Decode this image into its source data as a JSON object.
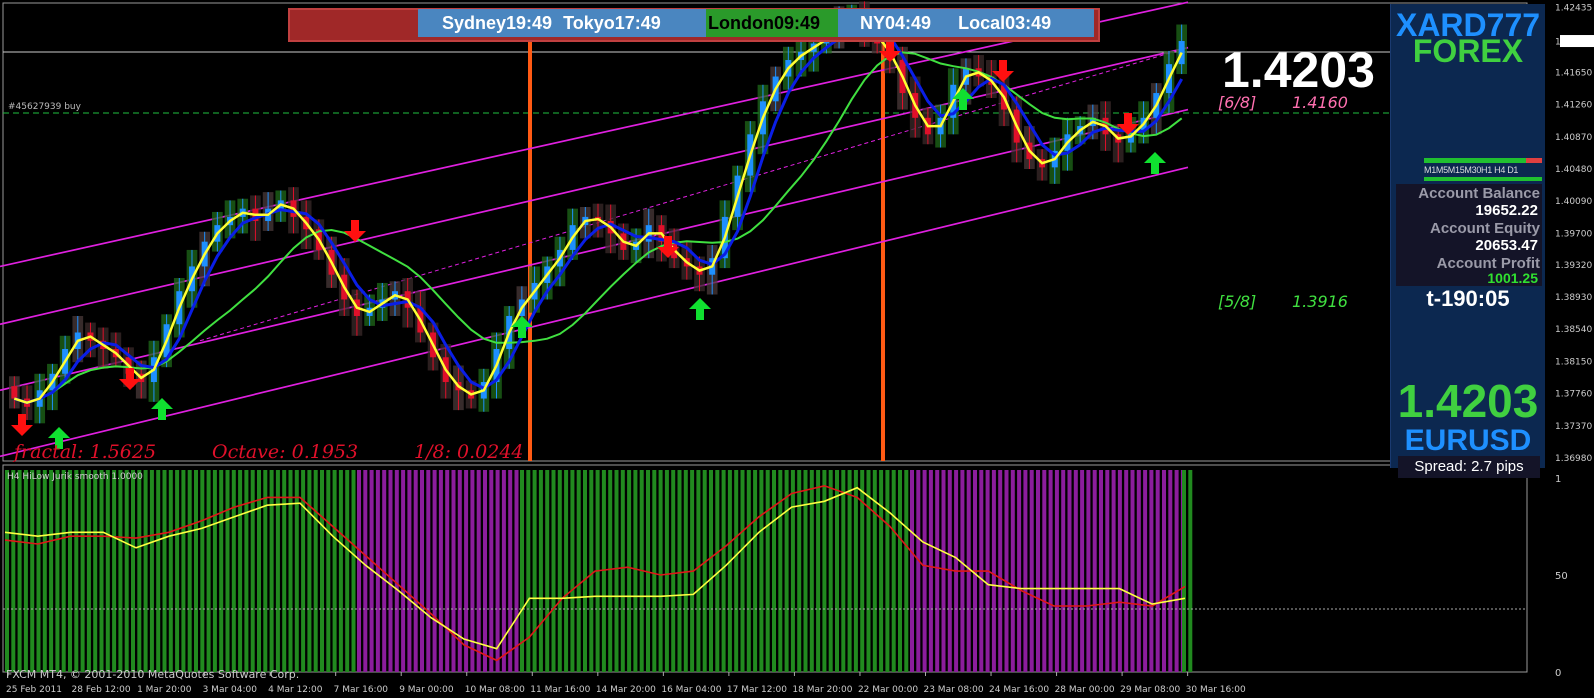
{
  "sessions": {
    "sydney_label": "Sydney",
    "sydney_time": "19:49",
    "tokyo_label": "Tokyo",
    "tokyo_time": "17:49",
    "london_label": "London",
    "london_time": "09:49",
    "ny_label": "NY",
    "ny_time": "04:49",
    "local_label": "Local",
    "local_time": "03:49"
  },
  "order_label": "#45627939 buy",
  "big_price": "1.4203",
  "levels": {
    "six_eighths": "[6/8]",
    "six_eighths_value": "1.4160",
    "five_eighths": "[5/8]",
    "five_eighths_value": "1.3916"
  },
  "fractal_info": {
    "fractal": "fractal: 1.5625",
    "octave": "Octave: 0.1953",
    "eighth": "1/8: 0.0244"
  },
  "indicator_label": "H4 HiLow Jurik smooth 1.0000",
  "copyright": "FXCM MT4, © 2001-2010 MetaQuotes Software Corp.",
  "panel": {
    "brand_top": "XARD777",
    "brand_bottom": "FOREX",
    "timeframes": "M1M5M15M30H1 H4 D1",
    "account_balance_label": "Account Balance",
    "account_balance": "19652.22",
    "account_equity_label": "Account Equity",
    "account_equity": "20653.47",
    "account_profit_label": "Account Profit",
    "account_profit": "1001.25",
    "countdown": "t-190:05",
    "price": "1.4203",
    "symbol": "EURUSD",
    "spread": "Spread: 2.7 pips"
  },
  "colors": {
    "background": "#000000",
    "bull_candle": "#1e90ff",
    "bear_candle": "#e0102a",
    "channel": "#e020e0",
    "ma_blue": "#0a1ee6",
    "ma_green": "#40e040",
    "ma_yellow": "#ffff33",
    "session_line": "#ff5a14",
    "panel_bg": "#0c2850",
    "bar_green": "#218a1f",
    "bar_purple": "#8b1d9c"
  },
  "chart_data": [
    {
      "type": "candlestick",
      "symbol": "EURUSD",
      "timeframe": "H4",
      "current_price": 1.4203,
      "ylim": [
        1.3698,
        1.4243
      ],
      "y_ticks": [
        "1.42435",
        "1.42025",
        "1.41650",
        "1.41260",
        "1.40870",
        "1.40480",
        "1.40090",
        "1.39700",
        "1.39320",
        "1.38930",
        "1.38540",
        "1.38150",
        "1.37760",
        "1.37370",
        "1.36980"
      ],
      "x_ticks": [
        "25 Feb 2011",
        "28 Feb 12:00",
        "1 Mar 20:00",
        "3 Mar 04:00",
        "4 Mar 12:00",
        "7 Mar 16:00",
        "9 Mar 00:00",
        "10 Mar 08:00",
        "11 Mar 16:00",
        "14 Mar 20:00",
        "16 Mar 04:00",
        "17 Mar 12:00",
        "18 Mar 20:00",
        "22 Mar 00:00",
        "23 Mar 08:00",
        "24 Mar 16:00",
        "28 Mar 00:00",
        "29 Mar 08:00",
        "30 Mar 16:00"
      ],
      "close_series": [
        1.377,
        1.376,
        1.378,
        1.38,
        1.383,
        1.385,
        1.384,
        1.383,
        1.382,
        1.38,
        1.379,
        1.382,
        1.386,
        1.39,
        1.393,
        1.396,
        1.398,
        1.399,
        1.4,
        1.3985,
        1.4,
        1.401,
        1.399,
        1.3975,
        1.395,
        1.392,
        1.389,
        1.387,
        1.388,
        1.389,
        1.39,
        1.388,
        1.385,
        1.382,
        1.379,
        1.378,
        1.377,
        1.379,
        1.383,
        1.387,
        1.389,
        1.391,
        1.393,
        1.395,
        1.398,
        1.399,
        1.3985,
        1.397,
        1.395,
        1.396,
        1.398,
        1.396,
        1.394,
        1.393,
        1.392,
        1.394,
        1.399,
        1.404,
        1.409,
        1.413,
        1.416,
        1.418,
        1.419,
        1.42,
        1.421,
        1.4225,
        1.4235,
        1.422,
        1.42,
        1.418,
        1.414,
        1.411,
        1.409,
        1.411,
        1.415,
        1.417,
        1.416,
        1.415,
        1.412,
        1.408,
        1.406,
        1.405,
        1.407,
        1.409,
        1.41,
        1.411,
        1.409,
        1.408,
        1.4095,
        1.411,
        1.414,
        1.4175,
        1.4203
      ]
    },
    {
      "type": "line",
      "title": "H4 HiLow Jurik smooth 1.0000",
      "ylim": [
        0,
        1
      ],
      "y_ticks": [
        "1",
        "50",
        "0"
      ],
      "series": [
        {
          "color": "red",
          "values": [
            0.68,
            0.66,
            0.7,
            0.7,
            0.69,
            0.72,
            0.78,
            0.85,
            0.9,
            0.9,
            0.75,
            0.6,
            0.45,
            0.3,
            0.14,
            0.06,
            0.18,
            0.38,
            0.52,
            0.54,
            0.5,
            0.52,
            0.65,
            0.8,
            0.92,
            0.96,
            0.9,
            0.75,
            0.55,
            0.52,
            0.52,
            0.42,
            0.34,
            0.34,
            0.36,
            0.34,
            0.44
          ]
        },
        {
          "color": "yellow",
          "values": [
            0.72,
            0.7,
            0.72,
            0.72,
            0.64,
            0.7,
            0.74,
            0.8,
            0.86,
            0.87,
            0.7,
            0.55,
            0.42,
            0.28,
            0.17,
            0.12,
            0.38,
            0.38,
            0.39,
            0.39,
            0.39,
            0.4,
            0.55,
            0.72,
            0.85,
            0.88,
            0.95,
            0.82,
            0.67,
            0.59,
            0.45,
            0.43,
            0.43,
            0.43,
            0.43,
            0.35,
            0.38
          ]
        }
      ],
      "bars": [
        {
          "color": "green",
          "from": "25 Feb 2011",
          "to": "7 Mar 16:00"
        },
        {
          "color": "purple",
          "from": "7 Mar 16:00",
          "to": "11 Mar 16:00"
        },
        {
          "color": "green",
          "from": "11 Mar 16:00",
          "to": "22 Mar 20:00"
        },
        {
          "color": "purple",
          "from": "22 Mar 20:00",
          "to": "30 Mar 20:00"
        },
        {
          "color": "green",
          "from": "30 Mar 20:00",
          "to": "31 Mar 00:00"
        }
      ]
    }
  ]
}
